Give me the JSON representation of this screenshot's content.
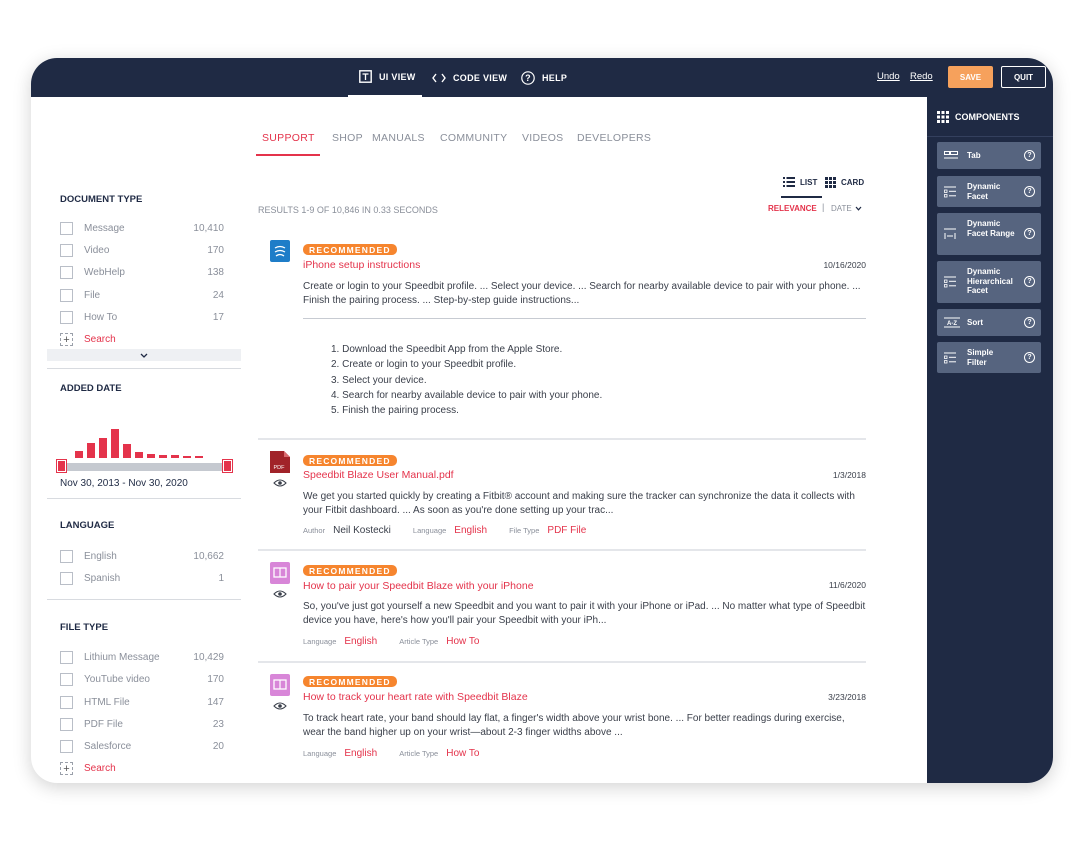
{
  "topbar": {
    "tabs": [
      {
        "label": "UI VIEW",
        "icon": "layout-icon"
      },
      {
        "label": "CODE VIEW",
        "icon": "code-icon"
      },
      {
        "label": "HELP",
        "icon": "help-icon"
      }
    ],
    "undo": "Undo",
    "redo": "Redo",
    "save": "SAVE",
    "quit": "QUIT"
  },
  "nav": {
    "tabs": [
      "SUPPORT",
      "SHOP",
      "MANUALS",
      "COMMUNITY",
      "VIDEOS",
      "DEVELOPERS"
    ],
    "active": "SUPPORT"
  },
  "filters": {
    "document_type": {
      "title": "DOCUMENT TYPE",
      "items": [
        {
          "label": "Message",
          "count": "10,410"
        },
        {
          "label": "Video",
          "count": "170"
        },
        {
          "label": "WebHelp",
          "count": "138"
        },
        {
          "label": "File",
          "count": "24"
        },
        {
          "label": "How To",
          "count": "17"
        }
      ],
      "search": "Search"
    },
    "added_date": {
      "title": "ADDED DATE",
      "range": "Nov 30, 2013 - Nov 30, 2020",
      "histogram": [
        0.22,
        0.48,
        0.62,
        0.9,
        0.44,
        0.2,
        0.12,
        0.1,
        0.08,
        0.06,
        0.05
      ]
    },
    "language": {
      "title": "LANGUAGE",
      "items": [
        {
          "label": "English",
          "count": "10,662"
        },
        {
          "label": "Spanish",
          "count": "1"
        }
      ]
    },
    "file_type": {
      "title": "FILE TYPE",
      "items": [
        {
          "label": "Lithium Message",
          "count": "10,429"
        },
        {
          "label": "YouTube video",
          "count": "170"
        },
        {
          "label": "HTML File",
          "count": "147"
        },
        {
          "label": "PDF File",
          "count": "23"
        },
        {
          "label": "Salesforce",
          "count": "20"
        }
      ],
      "search": "Search"
    }
  },
  "results": {
    "summary": "RESULTS 1-9 OF 10,846 IN 0.33 SECONDS",
    "view_list": "LIST",
    "view_card": "CARD",
    "sort_relevance": "RELEVANCE",
    "sort_separator": "|",
    "sort_date": "DATE",
    "items": [
      {
        "badge": "RECOMMENDED",
        "title": "iPhone setup instructions",
        "date": "10/16/2020",
        "excerpt": "Create or login to your Speedbit profile. ... Select your device. ... Search for nearby available device to pair with your phone. ... Finish the pairing process. ... Step-by-step guide instructions...",
        "steps": [
          "1. Download the Speedbit App from the Apple Store.",
          "2. Create or login to your Speedbit profile.",
          "3. Select your device.",
          "4. Search for nearby available device to pair with your phone.",
          "5. Finish the pairing process."
        ]
      },
      {
        "badge": "RECOMMENDED",
        "title": "Speedbit Blaze User Manual.pdf",
        "date": "1/3/2018",
        "excerpt": "We get you started quickly by creating a Fitbit® account and making sure the tracker can synchronize the data it collects with your Fitbit dashboard. ... As soon as you're done setting up your trac...",
        "meta": [
          {
            "key": "Author",
            "value": "Neil Kostecki"
          },
          {
            "key": "Language",
            "value": "English"
          },
          {
            "key": "File Type",
            "value": "PDF File"
          }
        ],
        "icon_label": "PDF"
      },
      {
        "badge": "RECOMMENDED",
        "title": "How to pair your Speedbit Blaze with your iPhone",
        "date": "11/6/2020",
        "excerpt": "So, you've just got yourself a new Speedbit and you want to pair it with your iPhone or iPad. ... No matter what type of Speedbit device you have, here's how you'll pair your Speedbit with your iPh...",
        "meta": [
          {
            "key": "Language",
            "value": "English"
          },
          {
            "key": "Article Type",
            "value": "How To"
          }
        ]
      },
      {
        "badge": "RECOMMENDED",
        "title": "How to track your heart rate with Speedbit Blaze",
        "date": "3/23/2018",
        "excerpt": "To track heart rate, your band should lay flat, a finger's width above your wrist bone. ... For better readings during exercise, wear the band higher up on your wrist—about 2-3 finger widths above ...",
        "meta": [
          {
            "key": "Language",
            "value": "English"
          },
          {
            "key": "Article Type",
            "value": "How To"
          }
        ]
      }
    ]
  },
  "components": {
    "title": "COMPONENTS",
    "items": [
      {
        "label": "Tab",
        "icon": "tab-icon"
      },
      {
        "label": "Dynamic Facet",
        "icon": "facet-icon"
      },
      {
        "label": "Dynamic Facet Range",
        "icon": "facet-range-icon"
      },
      {
        "label": "Dynamic Hierarchical Facet",
        "icon": "hierarchical-facet-icon"
      },
      {
        "label": "Sort",
        "icon": "sort-icon"
      },
      {
        "label": "Simple Filter",
        "icon": "filter-icon"
      }
    ]
  },
  "colors": {
    "navy": "#1f2a44",
    "accent_red": "#e4334b",
    "badge_orange": "#f6852e",
    "save_orange": "#f6a15c",
    "component_gray": "#56647f"
  }
}
